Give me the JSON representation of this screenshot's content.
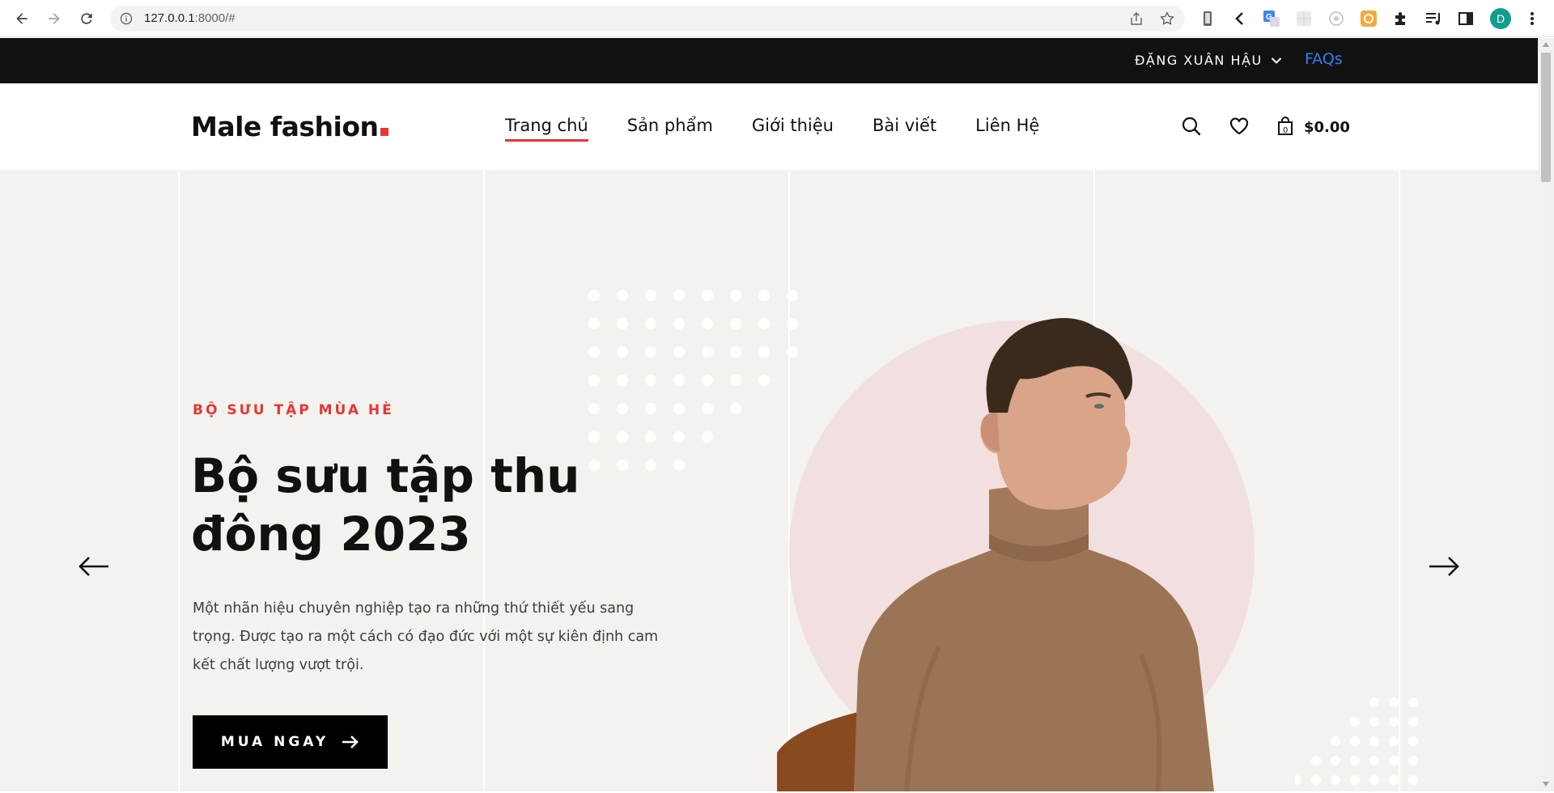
{
  "browser": {
    "url_host": "127.0.0.1",
    "url_rest": ":8000/#",
    "profile_initial": "D"
  },
  "topbar": {
    "account_name": "ĐẶNG XUÂN HẬU",
    "faqs_label": "FAQs"
  },
  "header": {
    "logo_text": "Male fashion",
    "nav_items": [
      {
        "label": "Trang chủ",
        "active": true
      },
      {
        "label": "Sản phẩm",
        "active": false
      },
      {
        "label": "Giới thiệu",
        "active": false
      },
      {
        "label": "Bài viết",
        "active": false
      },
      {
        "label": "Liên Hệ",
        "active": false
      }
    ],
    "cart_count": "0",
    "cart_total": "$0.00"
  },
  "hero": {
    "subtitle": "BỘ SƯU TẬP MÙA HÈ",
    "title": "Bộ sưu tập thu đông 2023",
    "description": "Một nhãn hiệu chuyên nghiệp tạo ra những thứ thiết yếu sang trọng. Được tạo ra một cách có đạo đức với một sự kiên định cam kết chất lượng vượt trội.",
    "cta_label": "MUA NGAY"
  },
  "colors": {
    "accent": "#e53637",
    "topbar_bg": "#111111",
    "hero_bg": "#f3f2ee",
    "circle": "#f2dfdf",
    "link_blue": "#2f7ff5"
  }
}
